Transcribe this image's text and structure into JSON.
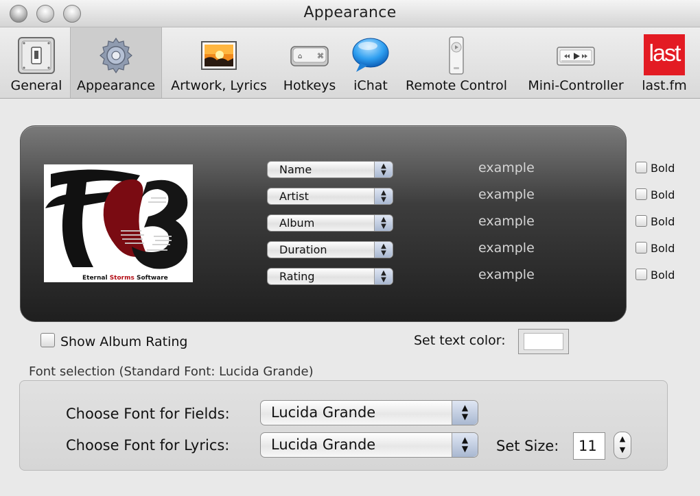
{
  "window": {
    "title": "Appearance"
  },
  "toolbar": {
    "items": [
      {
        "label": "General",
        "icon": "switch-icon"
      },
      {
        "label": "Appearance",
        "icon": "gear-icon",
        "selected": true
      },
      {
        "label": "Artwork, Lyrics",
        "icon": "artwork-icon"
      },
      {
        "label": "Hotkeys",
        "icon": "keyboard-icon"
      },
      {
        "label": "iChat",
        "icon": "speech-bubble-icon"
      },
      {
        "label": "Remote Control",
        "icon": "remote-icon"
      },
      {
        "label": "Mini-Controller",
        "icon": "mini-controller-icon"
      },
      {
        "label": "last.fm",
        "icon": "lastfm-icon"
      }
    ],
    "lastfm_logo_text": "last"
  },
  "fields": [
    {
      "field": "Name",
      "example": "example",
      "bold_label": "Bold",
      "bold": false
    },
    {
      "field": "Artist",
      "example": "example",
      "bold_label": "Bold",
      "bold": false
    },
    {
      "field": "Album",
      "example": "example",
      "bold_label": "Bold",
      "bold": false
    },
    {
      "field": "Duration",
      "example": "example",
      "bold_label": "Bold",
      "bold": false
    },
    {
      "field": "Rating",
      "example": "example",
      "bold_label": "Bold",
      "bold": false
    }
  ],
  "artwork": {
    "caption_1": "Eternal ",
    "caption_2": "Storms",
    "caption_3": " Software"
  },
  "options": {
    "show_album_rating_label": "Show Album Rating",
    "show_album_rating": false,
    "set_text_color_label": "Set text color:",
    "text_color": "#ffffff"
  },
  "fonts": {
    "section_label": "Font selection (Standard Font: Lucida Grande)",
    "fields_label": "Choose Font for Fields:",
    "fields_font": "Lucida Grande",
    "lyrics_label": "Choose Font for Lyrics:",
    "lyrics_font": "Lucida Grande",
    "size_label": "Set Size:",
    "size_value": "11"
  },
  "colors": {
    "lastfm": "#e31b23",
    "ichat": "#1a8fe8"
  }
}
